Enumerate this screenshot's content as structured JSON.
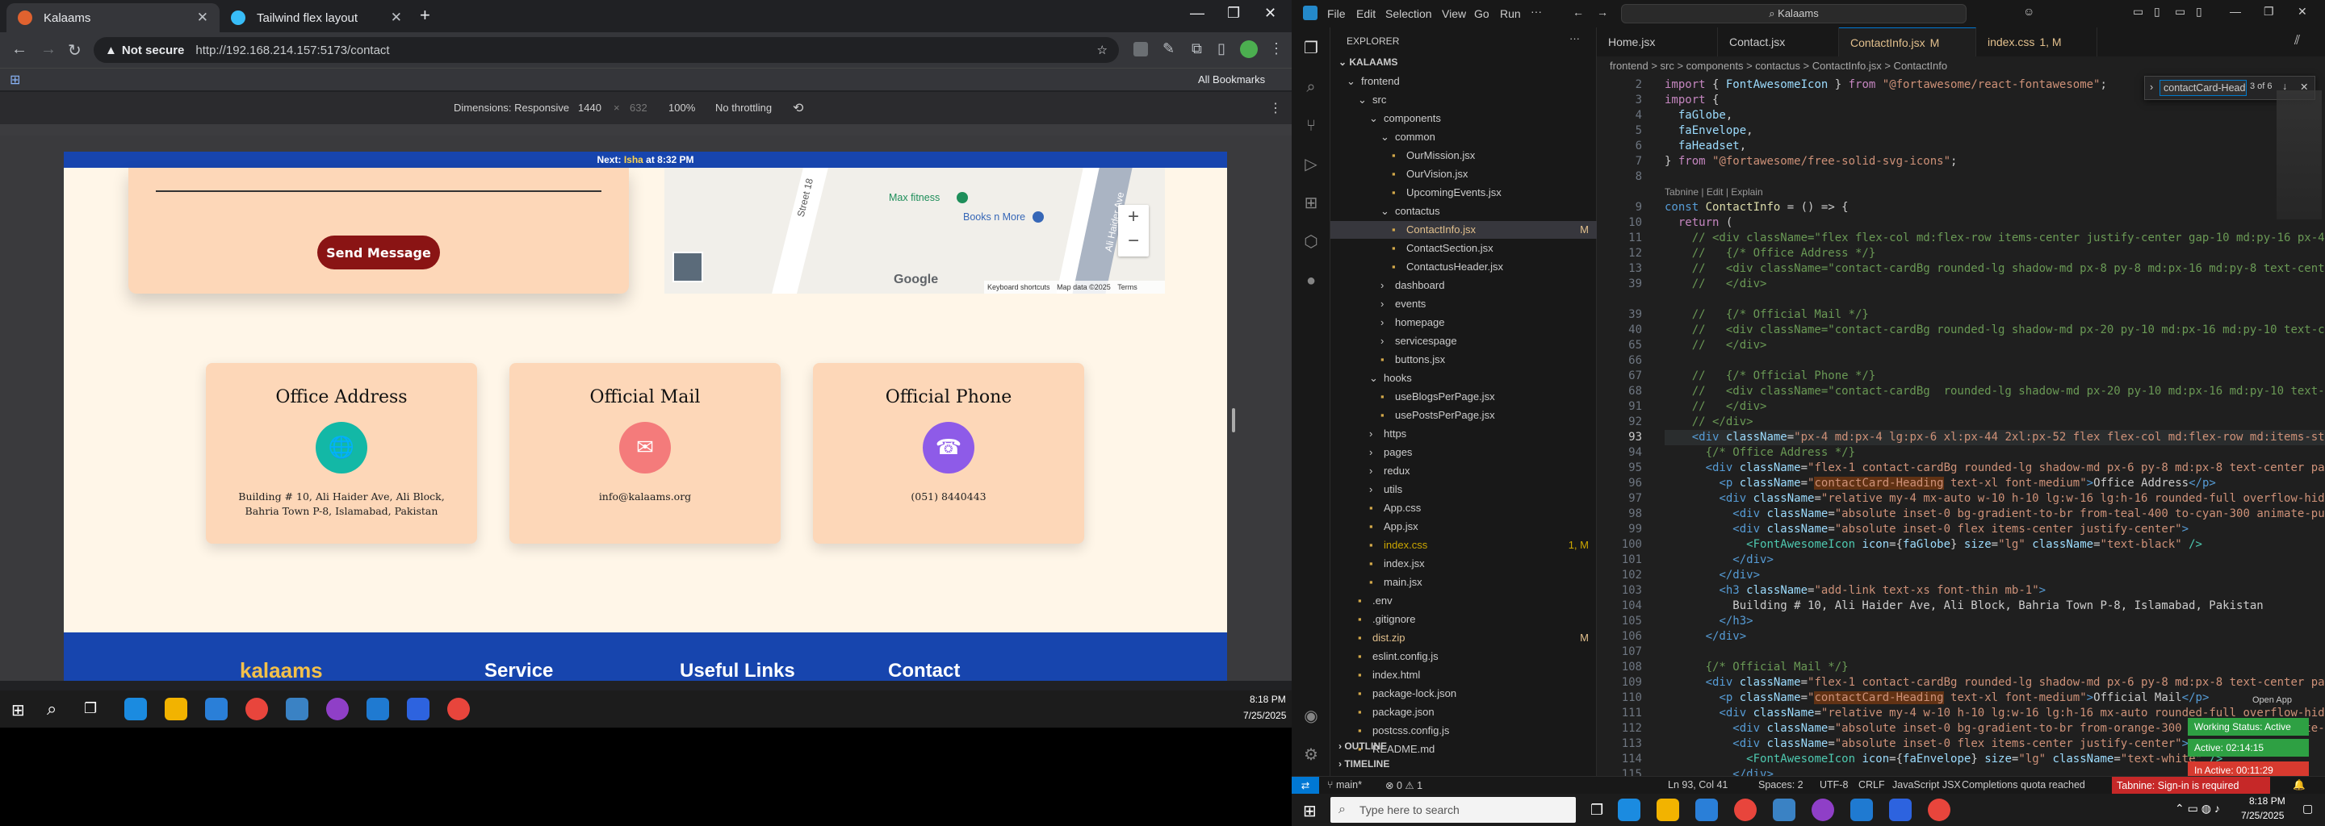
{
  "chrome": {
    "tabs": [
      {
        "label": "Kalaams",
        "active": true
      },
      {
        "label": "Tailwind flex layout",
        "active": false
      }
    ],
    "url_secure": "Not secure",
    "url": "http://192.168.214.157:5173/contact",
    "bookmarks": "All Bookmarks",
    "devtools": {
      "dimensions": "Dimensions: Responsive",
      "width": "1440",
      "height": "632",
      "zoom": "100%",
      "throttle": "No throttling"
    }
  },
  "site": {
    "banner_prefix": "Next: ",
    "banner_bold": "Isha",
    "banner_suffix": " at 8:32 PM",
    "send": "Send Message",
    "map": {
      "poi1": "Max fitness",
      "poi2": "Books n More",
      "street1": "Street 18",
      "street2": "Ali Haider Ave",
      "kb": "Keyboard shortcuts",
      "md": "Map data ©2025",
      "terms": "Terms",
      "google": "Google"
    },
    "cards": [
      {
        "title": "Office Address",
        "text": "Building # 10, Ali Haider Ave, Ali Block, Bahria Town P-8, Islamabad, Pakistan",
        "icon": "globe-icon",
        "color": "#13b8a6"
      },
      {
        "title": "Official Mail",
        "text": "info@kalaams.org",
        "icon": "envelope-icon",
        "color": "#f47b7b"
      },
      {
        "title": "Official Phone",
        "text": "(051) 8440443",
        "icon": "headset-icon",
        "color": "#8e5be8"
      }
    ],
    "footer": {
      "brand": "kalaams",
      "cols": [
        "Service",
        "Useful Links",
        "Contact"
      ]
    }
  },
  "taskbar_left": {
    "time": "8:18 PM",
    "date": "7/25/2025"
  },
  "vscode": {
    "title": "Kalaams",
    "explorer": "EXPLORER",
    "project": "KALAAMS",
    "tree": [
      {
        "l": "frontend",
        "d": 1,
        "f": true,
        "o": true
      },
      {
        "l": "src",
        "d": 2,
        "f": true,
        "o": true
      },
      {
        "l": "components",
        "d": 3,
        "f": true,
        "o": true
      },
      {
        "l": "common",
        "d": 4,
        "f": true,
        "o": true
      },
      {
        "l": "OurMission.jsx",
        "d": 5
      },
      {
        "l": "OurVision.jsx",
        "d": 5
      },
      {
        "l": "UpcomingEvents.jsx",
        "d": 5
      },
      {
        "l": "contactus",
        "d": 4,
        "f": true,
        "o": true
      },
      {
        "l": "ContactInfo.jsx",
        "d": 5,
        "b": "M",
        "sel": true
      },
      {
        "l": "ContactSection.jsx",
        "d": 5
      },
      {
        "l": "ContactusHeader.jsx",
        "d": 5
      },
      {
        "l": "dashboard",
        "d": 4,
        "f": true
      },
      {
        "l": "events",
        "d": 4,
        "f": true
      },
      {
        "l": "homepage",
        "d": 4,
        "f": true
      },
      {
        "l": "servicespage",
        "d": 4,
        "f": true
      },
      {
        "l": "buttons.jsx",
        "d": 4
      },
      {
        "l": "hooks",
        "d": 3,
        "f": true,
        "o": true
      },
      {
        "l": "useBlogsPerPage.jsx",
        "d": 4
      },
      {
        "l": "usePostsPerPage.jsx",
        "d": 4
      },
      {
        "l": "https",
        "d": 3,
        "f": true
      },
      {
        "l": "pages",
        "d": 3,
        "f": true
      },
      {
        "l": "redux",
        "d": 3,
        "f": true
      },
      {
        "l": "utils",
        "d": 3,
        "f": true
      },
      {
        "l": "App.css",
        "d": 3
      },
      {
        "l": "App.jsx",
        "d": 3
      },
      {
        "l": "index.css",
        "d": 3,
        "b": "1, M",
        "w": true
      },
      {
        "l": "index.jsx",
        "d": 3
      },
      {
        "l": "main.jsx",
        "d": 3
      },
      {
        "l": ".env",
        "d": 2
      },
      {
        "l": ".gitignore",
        "d": 2
      },
      {
        "l": "dist.zip",
        "d": 2,
        "b": "M"
      },
      {
        "l": "eslint.config.js",
        "d": 2
      },
      {
        "l": "index.html",
        "d": 2
      },
      {
        "l": "package-lock.json",
        "d": 2
      },
      {
        "l": "package.json",
        "d": 2
      },
      {
        "l": "postcss.config.js",
        "d": 2
      },
      {
        "l": "README.md",
        "d": 2
      }
    ],
    "outline": "OUTLINE",
    "timeline": "TIMELINE",
    "tabs": [
      {
        "l": "Home.jsx"
      },
      {
        "l": "Contact.jsx"
      },
      {
        "l": "ContactInfo.jsx",
        "b": "M",
        "active": true
      },
      {
        "l": "index.css",
        "b": "1, M"
      }
    ],
    "breadcrumb": "frontend > src > components > contactus > ContactInfo.jsx > ContactInfo",
    "find": {
      "value": "contactCard-Heading",
      "count": "3 of 6"
    },
    "lines": [
      [
        "2",
        "<span class=\"kw\">import</span> { <span class=\"var\">FontAwesomeIcon</span> } <span class=\"kw\">from</span> <span class=\"str\">\"@fortawesome/react-fontawesome\"</span>;"
      ],
      [
        "3",
        "<span class=\"kw\">import</span> {"
      ],
      [
        "4",
        "  <span class=\"var\">faGlobe</span>,"
      ],
      [
        "5",
        "  <span class=\"var\">faEnvelope</span>,"
      ],
      [
        "6",
        "  <span class=\"var\">faHeadset</span>,"
      ],
      [
        "7",
        "} <span class=\"kw\">from</span> <span class=\"str\">\"@fortawesome/free-solid-svg-icons\"</span>;"
      ],
      [
        "8",
        ""
      ],
      [
        "",
        "<span style=\"color:#999;font-size:12px;font-family:'Liberation Sans',sans-serif\">Tabnine | Edit | Explain</span>"
      ],
      [
        "9",
        "<span class=\"tag\">const</span> <span class=\"fn\">ContactInfo</span> = () => {"
      ],
      [
        "10",
        "  <span class=\"kw\">return</span> ("
      ],
      [
        "11",
        "<span class=\"cm\">    // &lt;div className=\"flex flex-col md:flex-row items-center justify-center gap-10 md:py-16 px-4\"&gt;</span>"
      ],
      [
        "12",
        "<span class=\"cm\">    //   {/* Office Address */}</span>"
      ],
      [
        "13",
        "<span class=\"cm\">    //   &lt;div className=\"contact-cardBg rounded-lg shadow-md px-8 py-8 md:px-16 md:py-8 text-center paragraph\"&gt;</span>"
      ],
      [
        "39",
        "<span class=\"cm\">    //   &lt;/div&gt;</span>"
      ],
      [
        "",
        ""
      ],
      [
        "39",
        "<span class=\"cm\">    //   {/* Official Mail */}</span>"
      ],
      [
        "40",
        "<span class=\"cm\">    //   &lt;div className=\"contact-cardBg rounded-lg shadow-md px-20 py-10 md:px-16 md:py-10 text-center paragraph\"&gt;</span>"
      ],
      [
        "65",
        "<span class=\"cm\">    //   &lt;/div&gt;</span>"
      ],
      [
        "66",
        ""
      ],
      [
        "67",
        "<span class=\"cm\">    //   {/* Official Phone */}</span>"
      ],
      [
        "68",
        "<span class=\"cm\">    //   &lt;div className=\"contact-cardBg  rounded-lg shadow-md px-20 py-10 md:px-16 md:py-10 text-center paragraph\"&gt;</span>"
      ],
      [
        "91",
        "<span class=\"cm\">    //   &lt;/div&gt;</span>"
      ],
      [
        "92",
        "<span class=\"cm\">    // &lt;/div&gt;</span>"
      ],
      [
        "93",
        "    <span class=\"tag\">&lt;div</span> <span class=\"att\">className</span>=<span class=\"str\">\"px-4 md:px-4 lg:px-6 xl:px-44 2xl:px-52 flex flex-col md:flex-row md:items-stretch justify-center\"</span>"
      ],
      [
        "94",
        "<span class=\"cm\">      {/* Office Address */}</span>"
      ],
      [
        "95",
        "      <span class=\"tag\">&lt;div</span> <span class=\"att\">className</span>=<span class=\"str\">\"flex-1 contact-cardBg rounded-lg shadow-md px-6 py-8 md:px-8 text-center paragraph\"</span><span class=\"tag\">&gt;</span>"
      ],
      [
        "96",
        "        <span class=\"tag\">&lt;p</span> <span class=\"att\">className</span>=<span class=\"str\">\"<span class=\"hl\">contactCard-Heading</span> text-xl font-medium\"</span><span class=\"tag\">&gt;</span>Office Address<span class=\"tag\">&lt;/p&gt;</span>"
      ],
      [
        "97",
        "        <span class=\"tag\">&lt;div</span> <span class=\"att\">className</span>=<span class=\"str\">\"relative my-4 mx-auto w-10 h-10 lg:w-16 lg:h-16 rounded-full overflow-hidden mb-3\"</span><span class=\"tag\">&gt;</span>"
      ],
      [
        "98",
        "          <span class=\"tag\">&lt;div</span> <span class=\"att\">className</span>=<span class=\"str\">\"absolute inset-0 bg-gradient-to-br from-teal-400 to-cyan-300 animate-pulse\"</span><span class=\"tag\">&gt;&lt;/div&gt;</span>"
      ],
      [
        "99",
        "          <span class=\"tag\">&lt;div</span> <span class=\"att\">className</span>=<span class=\"str\">\"absolute inset-0 flex items-center justify-center\"</span><span class=\"tag\">&gt;</span>"
      ],
      [
        "100",
        "            <span class=\"cls\">&lt;FontAwesomeIcon</span> <span class=\"att\">icon</span>={<span class=\"var\">faGlobe</span>} <span class=\"att\">size</span>=<span class=\"str\">\"lg\"</span> <span class=\"att\">className</span>=<span class=\"str\">\"text-black\"</span> <span class=\"cls\">/&gt;</span>"
      ],
      [
        "101",
        "          <span class=\"tag\">&lt;/div&gt;</span>"
      ],
      [
        "102",
        "        <span class=\"tag\">&lt;/div&gt;</span>"
      ],
      [
        "103",
        "        <span class=\"tag\">&lt;h3</span> <span class=\"att\">className</span>=<span class=\"str\">\"add-link text-xs font-thin mb-1\"</span><span class=\"tag\">&gt;</span>"
      ],
      [
        "104",
        "          Building # 10, Ali Haider Ave, Ali Block, Bahria Town P-8, Islamabad, Pakistan"
      ],
      [
        "105",
        "        <span class=\"tag\">&lt;/h3&gt;</span>"
      ],
      [
        "106",
        "      <span class=\"tag\">&lt;/div&gt;</span>"
      ],
      [
        "107",
        ""
      ],
      [
        "108",
        "<span class=\"cm\">      {/* Official Mail */}</span>"
      ],
      [
        "109",
        "      <span class=\"tag\">&lt;div</span> <span class=\"att\">className</span>=<span class=\"str\">\"flex-1 contact-cardBg rounded-lg shadow-md px-6 py-8 md:px-8 text-center paragraph\"</span><span class=\"tag\">&gt;</span>"
      ],
      [
        "110",
        "        <span class=\"tag\">&lt;p</span> <span class=\"att\">className</span>=<span class=\"str\">\"<span class=\"hl\">contactCard-Heading</span> text-xl font-medium\"</span><span class=\"tag\">&gt;</span>Official Mail<span class=\"tag\">&lt;/p&gt;</span>"
      ],
      [
        "111",
        "        <span class=\"tag\">&lt;div</span> <span class=\"att\">className</span>=<span class=\"str\">\"relative my-4 w-10 h-10 lg:w-16 lg:h-16 mx-auto rounded-full overflow-hidden mb-3\"</span><span class=\"tag\">&gt;</span>"
      ],
      [
        "112",
        "          <span class=\"tag\">&lt;div</span> <span class=\"att\">className</span>=<span class=\"str\">\"absolute inset-0 bg-gradient-to-br from-orange-300 to-pink-400 animate-pulse\"</span><span class=\"tag\">&gt;&lt;/div&gt;</span>"
      ],
      [
        "113",
        "          <span class=\"tag\">&lt;div</span> <span class=\"att\">className</span>=<span class=\"str\">\"absolute inset-0 flex items-center justify-center\"</span><span class=\"tag\">&gt;</span>"
      ],
      [
        "114",
        "            <span class=\"cls\">&lt;FontAwesomeIcon</span> <span class=\"att\">icon</span>={<span class=\"var\">faEnvelope</span>} <span class=\"att\">size</span>=<span class=\"str\">\"lg\"</span> <span class=\"att\">className</span>=<span class=\"str\">\"text-white\"</span> <span class=\"cls\">/&gt;</span>"
      ],
      [
        "115",
        "          <span class=\"tag\">&lt;/div&gt;</span>"
      ]
    ],
    "status": {
      "branch": "main*",
      "errors": "0",
      "warnings": "1",
      "pos": "Ln 93, Col 41",
      "spaces": "Spaces: 2",
      "enc": "UTF-8",
      "eol": "CRLF",
      "lang": "JavaScript JSX",
      "quota": "Completions quota reached",
      "tabnine": "Tabnine: Sign-in is required"
    },
    "badges": {
      "open": "Open App",
      "working": "Working Status: Active",
      "active": "Active: 02:14:15",
      "inactive": "In Active: 00:11:29"
    }
  },
  "taskbar_right": {
    "search": "Type here to search",
    "time": "8:18 PM",
    "date": "7/25/2025"
  }
}
